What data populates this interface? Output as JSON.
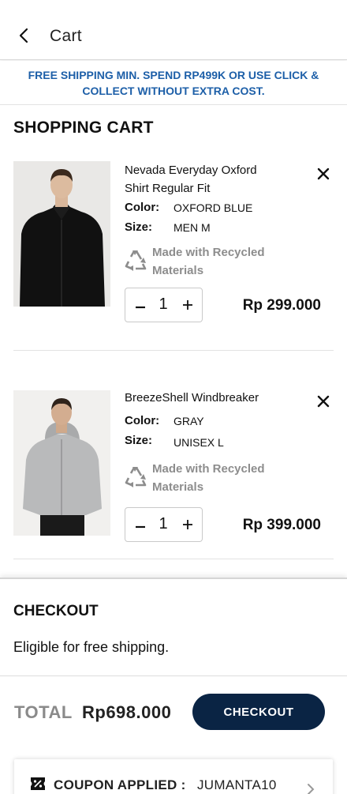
{
  "header": {
    "title": "Cart",
    "back_icon": "chevron-left-icon"
  },
  "banner": {
    "text": "FREE SHIPPING MIN. SPEND RP499K OR USE CLICK & COLLECT WITHOUT EXTRA COST."
  },
  "cart": {
    "title": "SHOPPING CART",
    "items": [
      {
        "name": "Nevada Everyday Oxford Shirt Regular Fit",
        "color_label": "Color:",
        "color": "OXFORD BLUE",
        "size_label": "Size:",
        "size": "MEN M",
        "recycled": "Made with Recycled Materials",
        "quantity": "1",
        "price": "Rp 299.000",
        "image": "black-oxford-shirt-photo"
      },
      {
        "name": "BreezeShell Windbreaker",
        "color_label": "Color:",
        "color": "GRAY",
        "size_label": "Size:",
        "size": "UNISEX L",
        "recycled": "Made with Recycled Materials",
        "quantity": "1",
        "price": "Rp 399.000",
        "image": "gray-windbreaker-photo"
      }
    ]
  },
  "checkout": {
    "title": "CHECKOUT",
    "note": "Eligible for free shipping.",
    "total_label": "TOTAL",
    "total_value": "Rp698.000",
    "button_label": "CHECKOUT",
    "coupon_label": "COUPON APPLIED :",
    "coupon_code": "JUMANTA10"
  },
  "colors": {
    "banner_text": "#1d5fa8",
    "checkout_button": "#0a2444",
    "muted_text": "#8d8d8d"
  }
}
